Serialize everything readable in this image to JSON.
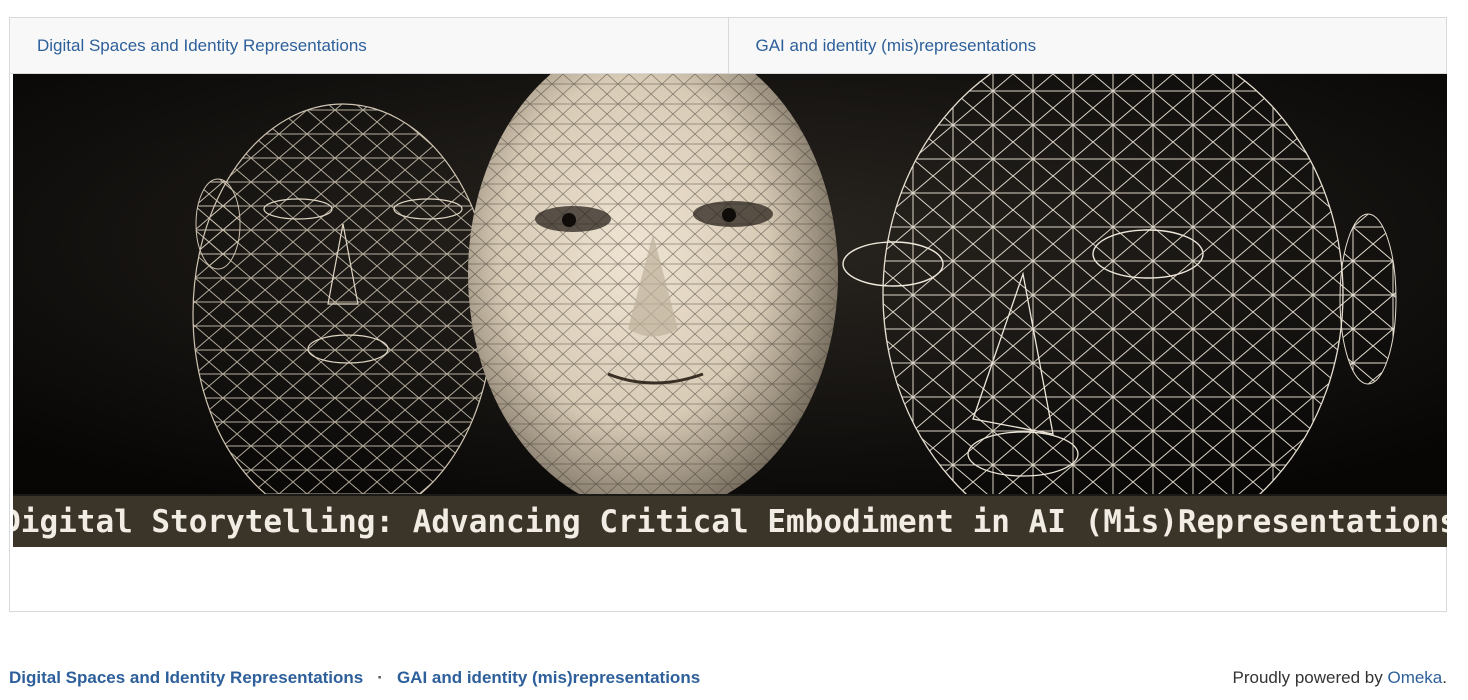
{
  "tabs": [
    {
      "label": "Digital Spaces and Identity Representations"
    },
    {
      "label": "GAI and identity (mis)representations"
    }
  ],
  "banner": {
    "caption": "Digital Storytelling: Advancing Critical Embodiment in AI (Mis)Representations"
  },
  "footer": {
    "links": [
      {
        "label": "Digital Spaces and Identity Representations"
      },
      {
        "label": "GAI and identity (mis)representations"
      }
    ],
    "separator": "·",
    "powered_prefix": "Proudly powered by ",
    "powered_link": "Omeka",
    "powered_suffix": "."
  }
}
